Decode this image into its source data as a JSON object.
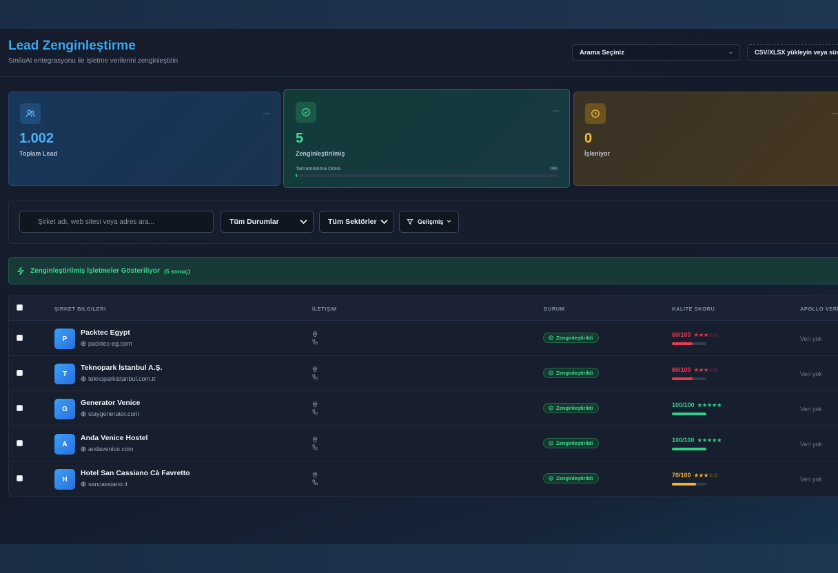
{
  "header": {
    "title": "Lead Zenginleştirme",
    "subtitle": "SmiloAI entegrasyonu ile işletme verilerini zenginleştirin",
    "search_select": "Arama Seçiniz",
    "upload_label": "CSV/XLSX yükleyin veya sürükleyin"
  },
  "stats": {
    "total": {
      "value": "1.002",
      "label": "Toplam Lead",
      "icon": "users-icon",
      "color": "#3aa6f0"
    },
    "enriched": {
      "value": "5",
      "label": "Zenginleştirilmiş",
      "icon": "check-circle-icon",
      "color": "#2fd08a",
      "rate_label": "Tamamlanma Oranı",
      "rate_value": "0%",
      "rate_fraction": 0.005
    },
    "processing": {
      "value": "0",
      "label": "İşleniyor",
      "icon": "clock-icon",
      "color": "#f2b233"
    }
  },
  "filters": {
    "search_placeholder": "Şirket adı, web sitesi veya adres ara...",
    "status": "Tüm Durumlar",
    "sector": "Tüm Sektörler",
    "advanced": "Gelişmiş"
  },
  "banner": {
    "text": "Zenginleştirilmiş İşletmeler Gösteriliyor",
    "count": "(5 sonuç)"
  },
  "table": {
    "columns": [
      "ŞIRKET BILGILERI",
      "İLETIŞIM",
      "DURUM",
      "KALITE SKORU",
      "APOLLO VERİSİ"
    ],
    "rows": [
      {
        "initial": "P",
        "name": "Packtec Egypt",
        "website": "packtec-eg.com",
        "status": "Zenginleştirildi",
        "score": "60/100",
        "stars": "★★★☆☆",
        "score_fraction": 0.6,
        "score_color": "#e8394f",
        "apollo": "Veri yok"
      },
      {
        "initial": "T",
        "name": "Teknopark İstanbul A.Ş.",
        "website": "teknoparkistanbul.com.tr",
        "status": "Zenginleştirildi",
        "score": "60/100",
        "stars": "★★★☆☆",
        "score_fraction": 0.6,
        "score_color": "#e8394f",
        "apollo": "Veri yok"
      },
      {
        "initial": "G",
        "name": "Generator Venice",
        "website": "staygenerator.com",
        "status": "Zenginleştirildi",
        "score": "100/100",
        "stars": "★★★★★",
        "score_fraction": 1.0,
        "score_color": "#2fd08a",
        "apollo": "Veri yok"
      },
      {
        "initial": "A",
        "name": "Anda Venice Hostel",
        "website": "andavenice.com",
        "status": "Zenginleştirildi",
        "score": "100/100",
        "stars": "★★★★★",
        "score_fraction": 1.0,
        "score_color": "#2fd08a",
        "apollo": "Veri yok"
      },
      {
        "initial": "H",
        "name": "Hotel San Cassiano Cà Favretto",
        "website": "sancassiano.it",
        "status": "Zenginleştirildi",
        "score": "70/100",
        "stars": "★★★☆☆",
        "score_fraction": 0.7,
        "score_color": "#f2b233",
        "apollo": "Veri yok"
      }
    ]
  }
}
